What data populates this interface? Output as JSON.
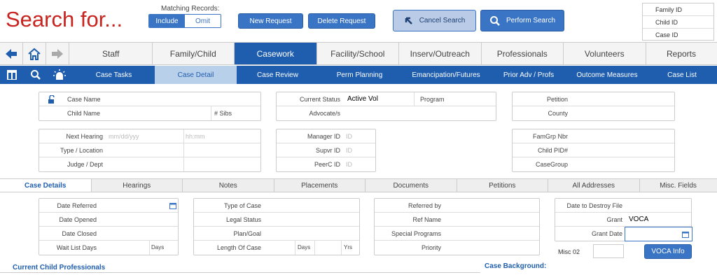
{
  "header": {
    "title": "Search for...",
    "matching_label": "Matching Records:",
    "include": "Include",
    "omit": "Omit",
    "new_request": "New Request",
    "delete_request": "Delete Request",
    "cancel_search": "Cancel Search",
    "perform_search": "Perform Search"
  },
  "idbox": {
    "family": "Family ID",
    "child": "Child ID",
    "case": "Case ID"
  },
  "main_tabs": [
    "Staff",
    "Family/Child",
    "Casework",
    "Facility/School",
    "Inserv/Outreach",
    "Professionals",
    "Volunteers",
    "Reports"
  ],
  "sub_tabs": [
    "Case Tasks",
    "Case Detail",
    "Case Review",
    "Perm Planning",
    "Emancipation/Futures",
    "Prior Adv / Profs",
    "Outcome Measures",
    "Case List"
  ],
  "case": {
    "case_name": "Case Name",
    "child_name": "Child Name",
    "sibs": "# Sibs",
    "current_status": "Current Status",
    "status_value": "Active Vol",
    "program": "Program",
    "advocates": "Advocate/s",
    "petition": "Petition",
    "county": "County"
  },
  "hearing": {
    "next_hearing": "Next Hearing",
    "date_ph": "mm/dd/yyy",
    "time_ph": "hh:mm",
    "type_location": "Type / Location",
    "judge_dept": "Judge / Dept"
  },
  "ids": {
    "manager": "Manager ID",
    "supvr": "Supvr ID",
    "peerc": "PeerC ID",
    "id_ph": "ID"
  },
  "fam": {
    "famgrp": "FamGrp Nbr",
    "child_pid": "Child PID#",
    "casegroup": "CaseGroup"
  },
  "detail_tabs": [
    "Case Details",
    "Hearings",
    "Notes",
    "Placements",
    "Documents",
    "Petitions",
    "All Addresses",
    "Misc. Fields"
  ],
  "dates": {
    "referred": "Date Referred",
    "opened": "Date Opened",
    "closed": "Date Closed",
    "wait_list": "Wait List Days",
    "days": "Days"
  },
  "typecase": {
    "type_of_case": "Type of Case",
    "legal_status": "Legal Status",
    "plan_goal": "Plan/Goal",
    "length_of_case": "Length Of Case",
    "days": "Days",
    "yrs": "Yrs"
  },
  "referral": {
    "referred_by": "Referred by",
    "ref_name": "Ref Name",
    "special_programs": "Special Programs",
    "priority": "Priority"
  },
  "grant": {
    "destroy": "Date to Destroy File",
    "grant": "Grant",
    "grant_value": "VOCA",
    "grant_date": "Grant Date",
    "misc02": "Misc 02",
    "voca_info": "VOCA Info"
  },
  "sections": {
    "professionals": "Current Child Professionals",
    "background": "Case Background:"
  }
}
